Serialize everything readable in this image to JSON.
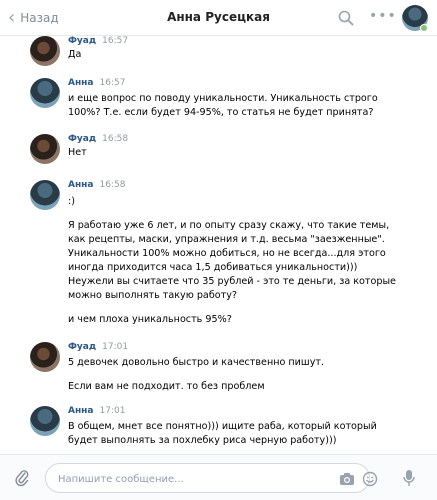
{
  "header": {
    "back_label": "Назад",
    "title": "Анна Русецкая"
  },
  "messages": [
    {
      "author": "Фуад",
      "avatar": "fuad",
      "time": "16:57",
      "lines": [
        "Да"
      ]
    },
    {
      "author": "Анна",
      "avatar": "anna",
      "time": "16:57",
      "lines": [
        "и еще вопрос по поводу уникальности. Уникальность строго",
        "100%? Т.е. если будет 94-95%, то статья не будет принята?"
      ]
    },
    {
      "author": "Фуад",
      "avatar": "fuad",
      "time": "16:58",
      "lines": [
        "Нет"
      ]
    },
    {
      "author": "Анна",
      "avatar": "anna",
      "time": "16:58",
      "lines": [
        ":)",
        "",
        "Я работаю уже 6 лет, и по опыту сразу скажу, что такие темы,",
        "как рецепты, маски, упражнения и т.д. весьма \"заезженные\".",
        "Уникальности 100% можно добиться, но не всегда...для этого",
        "иногда приходится часа 1,5 добиваться уникальности)))",
        "Неужели вы считаете что 35 рублей - это те деньги, за которые",
        "можно выполнять такую работу?",
        "",
        "и чем плоха уникальность 95%?"
      ]
    },
    {
      "author": "Фуад",
      "avatar": "fuad",
      "time": "17:01",
      "lines": [
        "5 девочек довольно быстро и качественно пишут.",
        "",
        "Если вам не подходит. то без проблем"
      ]
    },
    {
      "author": "Анна",
      "avatar": "anna",
      "time": "17:01",
      "lines": [
        "В общем, мнет все понятно))) ищите раба, который который",
        "будет выполнять за похлебку риса черную работу)))"
      ]
    }
  ],
  "composer": {
    "placeholder": "Напишите сообщение..."
  },
  "icons": {
    "back": "chevron-left-icon",
    "search": "search-icon",
    "more": "more-icon",
    "attach": "paperclip-icon",
    "camera": "camera-icon",
    "emoji": "smile-icon",
    "voice": "microphone-icon"
  },
  "colors": {
    "author": "#2a5885",
    "time": "#939aa3",
    "online": "#8ac176",
    "header_border": "#e7e8ec"
  }
}
